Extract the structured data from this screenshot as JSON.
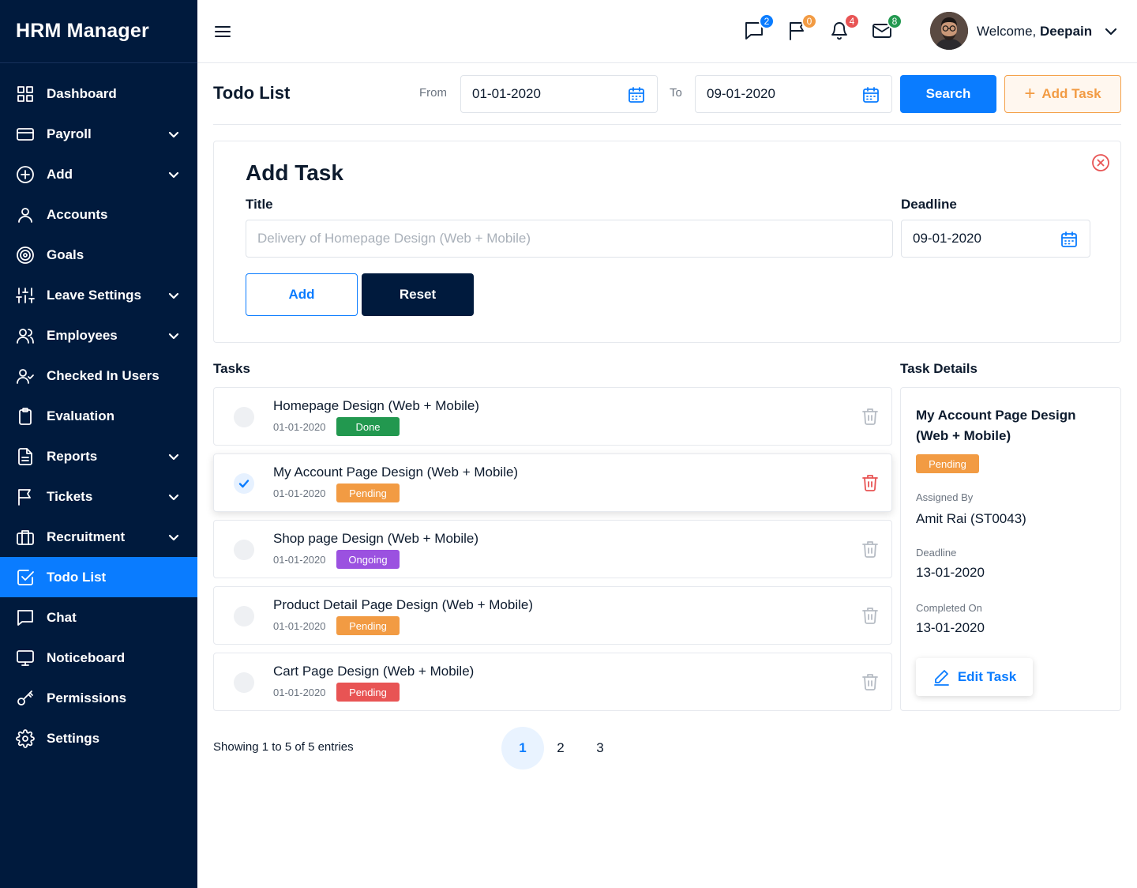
{
  "brand": "HRM Manager",
  "sidebar": {
    "items": [
      {
        "label": "Dashboard",
        "icon": "grid-icon"
      },
      {
        "label": "Payroll",
        "icon": "credit-card-icon"
      },
      {
        "label": "Add",
        "icon": "plus-circle-icon"
      },
      {
        "label": "Accounts",
        "icon": "user-icon"
      },
      {
        "label": "Goals",
        "icon": "target-icon"
      },
      {
        "label": "Leave Settings",
        "icon": "sliders-icon"
      },
      {
        "label": "Employees",
        "icon": "users-icon"
      },
      {
        "label": "Checked In Users",
        "icon": "user-check-icon"
      },
      {
        "label": "Evaluation",
        "icon": "clipboard-icon"
      },
      {
        "label": "Reports",
        "icon": "file-text-icon"
      },
      {
        "label": "Tickets",
        "icon": "flag-icon"
      },
      {
        "label": "Recruitment",
        "icon": "briefcase-icon"
      },
      {
        "label": "Todo List",
        "icon": "check-square-icon"
      },
      {
        "label": "Chat",
        "icon": "message-icon"
      },
      {
        "label": "Noticeboard",
        "icon": "monitor-icon"
      },
      {
        "label": "Permissions",
        "icon": "key-icon"
      },
      {
        "label": "Settings",
        "icon": "gear-icon"
      }
    ],
    "active": "Todo List"
  },
  "topbar": {
    "notifications": [
      {
        "icon": "chat-icon",
        "count": "2",
        "color": "#0a7cff"
      },
      {
        "icon": "flag-icon",
        "count": "0",
        "color": "#f29b43"
      },
      {
        "icon": "bell-icon",
        "count": "4",
        "color": "#e85454"
      },
      {
        "icon": "mail-icon",
        "count": "8",
        "color": "#22984f"
      }
    ],
    "welcome_prefix": "Welcome,",
    "user_name": "Deepain"
  },
  "header": {
    "title": "Todo List",
    "from_label": "From",
    "from_value": "01-01-2020",
    "to_label": "To",
    "to_value": "09-01-2020",
    "search_label": "Search",
    "add_task_label": "Add Task"
  },
  "add_task": {
    "title": "Add Task",
    "title_label": "Title",
    "title_placeholder": "Delivery of Homepage Design (Web + Mobile)",
    "deadline_label": "Deadline",
    "deadline_value": "09-01-2020",
    "add_label": "Add",
    "reset_label": "Reset"
  },
  "tasks": {
    "heading": "Tasks",
    "items": [
      {
        "title": "Homepage Design (Web + Mobile)",
        "date": "01-01-2020",
        "status": "Done",
        "status_color": "#22984f",
        "checked": false
      },
      {
        "title": "My Account Page Design (Web + Mobile)",
        "date": "01-01-2020",
        "status": "Pending",
        "status_color": "#f29b43",
        "checked": true
      },
      {
        "title": "Shop page Design (Web + Mobile)",
        "date": "01-01-2020",
        "status": "Ongoing",
        "status_color": "#9b51e0",
        "checked": false
      },
      {
        "title": "Product Detail Page Design (Web + Mobile)",
        "date": "01-01-2020",
        "status": "Pending",
        "status_color": "#f29b43",
        "checked": false
      },
      {
        "title": "Cart Page Design (Web + Mobile)",
        "date": "01-01-2020",
        "status": "Pending",
        "status_color": "#e85454",
        "checked": false
      }
    ]
  },
  "details": {
    "heading": "Task Details",
    "title": "My Account Page Design (Web + Mobile)",
    "status": "Pending",
    "status_color": "#f29b43",
    "assigned_by_label": "Assigned By",
    "assigned_by": "Amit Rai (ST0043)",
    "deadline_label": "Deadline",
    "deadline": "13-01-2020",
    "completed_label": "Completed On",
    "completed": "13-01-2020",
    "edit_label": "Edit Task"
  },
  "pagination": {
    "showing": "Showing 1 to 5 of 5 entries",
    "pages": [
      "1",
      "2",
      "3"
    ],
    "current": "1"
  }
}
